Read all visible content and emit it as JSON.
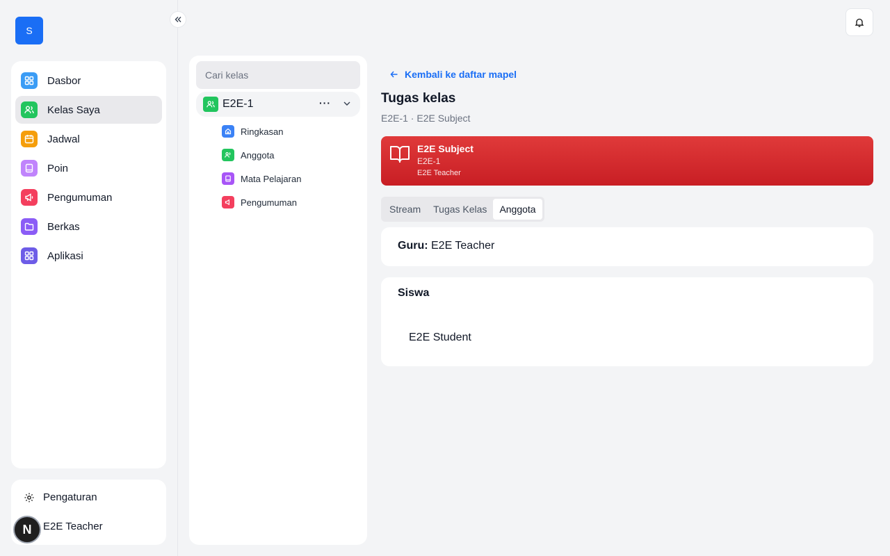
{
  "sidebar": {
    "logo_letter": "S",
    "items": [
      {
        "label": "Dasbor",
        "icon": "dashboard-icon",
        "color": "#3b9cf5",
        "active": false
      },
      {
        "label": "Kelas Saya",
        "icon": "users-icon",
        "color": "#22c55e",
        "active": true
      },
      {
        "label": "Jadwal",
        "icon": "calendar-icon",
        "color": "#f59e0b",
        "active": false
      },
      {
        "label": "Poin",
        "icon": "book-icon",
        "color": "#c084fc",
        "active": false
      },
      {
        "label": "Pengumuman",
        "icon": "megaphone-icon",
        "color": "#f43f5e",
        "active": false
      },
      {
        "label": "Berkas",
        "icon": "folder-icon",
        "color": "#8b5cf6",
        "active": false
      },
      {
        "label": "Aplikasi",
        "icon": "apps-icon",
        "color": "#6d5ce7",
        "active": false
      }
    ],
    "settings_label": "Pengaturan",
    "user_name": "E2E Teacher",
    "avatar_letter": "N"
  },
  "class_panel": {
    "search_placeholder": "Cari kelas",
    "class_name": "E2E-1",
    "more_label": "···",
    "sub_items": [
      {
        "label": "Ringkasan",
        "icon": "home-icon",
        "color": "#3b82f6"
      },
      {
        "label": "Anggota",
        "icon": "users-icon",
        "color": "#22c55e"
      },
      {
        "label": "Mata Pelajaran",
        "icon": "book-icon",
        "color": "#a855f7"
      },
      {
        "label": "Pengumuman",
        "icon": "megaphone-icon",
        "color": "#f43f5e"
      }
    ]
  },
  "main": {
    "back_label": "Kembali ke daftar mapel",
    "title": "Tugas kelas",
    "subtitle": "E2E-1 · E2E Subject",
    "banner": {
      "subject": "E2E Subject",
      "class": "E2E-1",
      "teacher": "E2E Teacher",
      "color": "#d42a2f"
    },
    "tabs": [
      {
        "label": "Stream",
        "active": false
      },
      {
        "label": "Tugas Kelas",
        "active": false
      },
      {
        "label": "Anggota",
        "active": true
      }
    ],
    "guru_label": "Guru:",
    "guru_name": "E2E Teacher",
    "siswa_title": "Siswa",
    "students": [
      "E2E Student"
    ]
  },
  "colors": {
    "accent": "#1a6ef5"
  }
}
